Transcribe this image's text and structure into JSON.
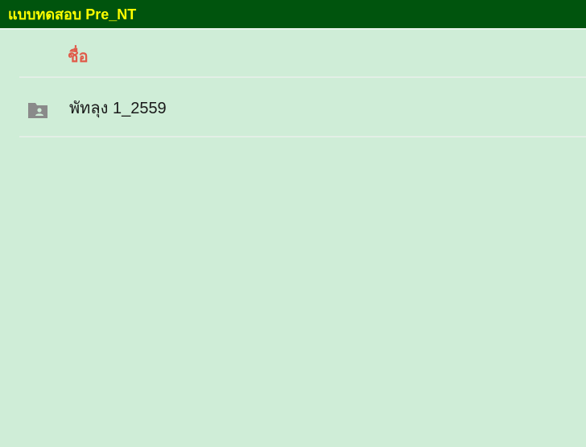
{
  "header": {
    "title": "แบบทดสอบ Pre_NT"
  },
  "table": {
    "column_name_label": "ชื่อ",
    "rows": [
      {
        "icon": "shared-folder-icon",
        "label": "พัทลุง 1_2559"
      }
    ]
  },
  "colors": {
    "header_bg": "#00540d",
    "header_text": "#ffff00",
    "page_bg": "#cfedd7",
    "column_header_text": "#e05b4a",
    "icon": "#8a8a8a"
  }
}
